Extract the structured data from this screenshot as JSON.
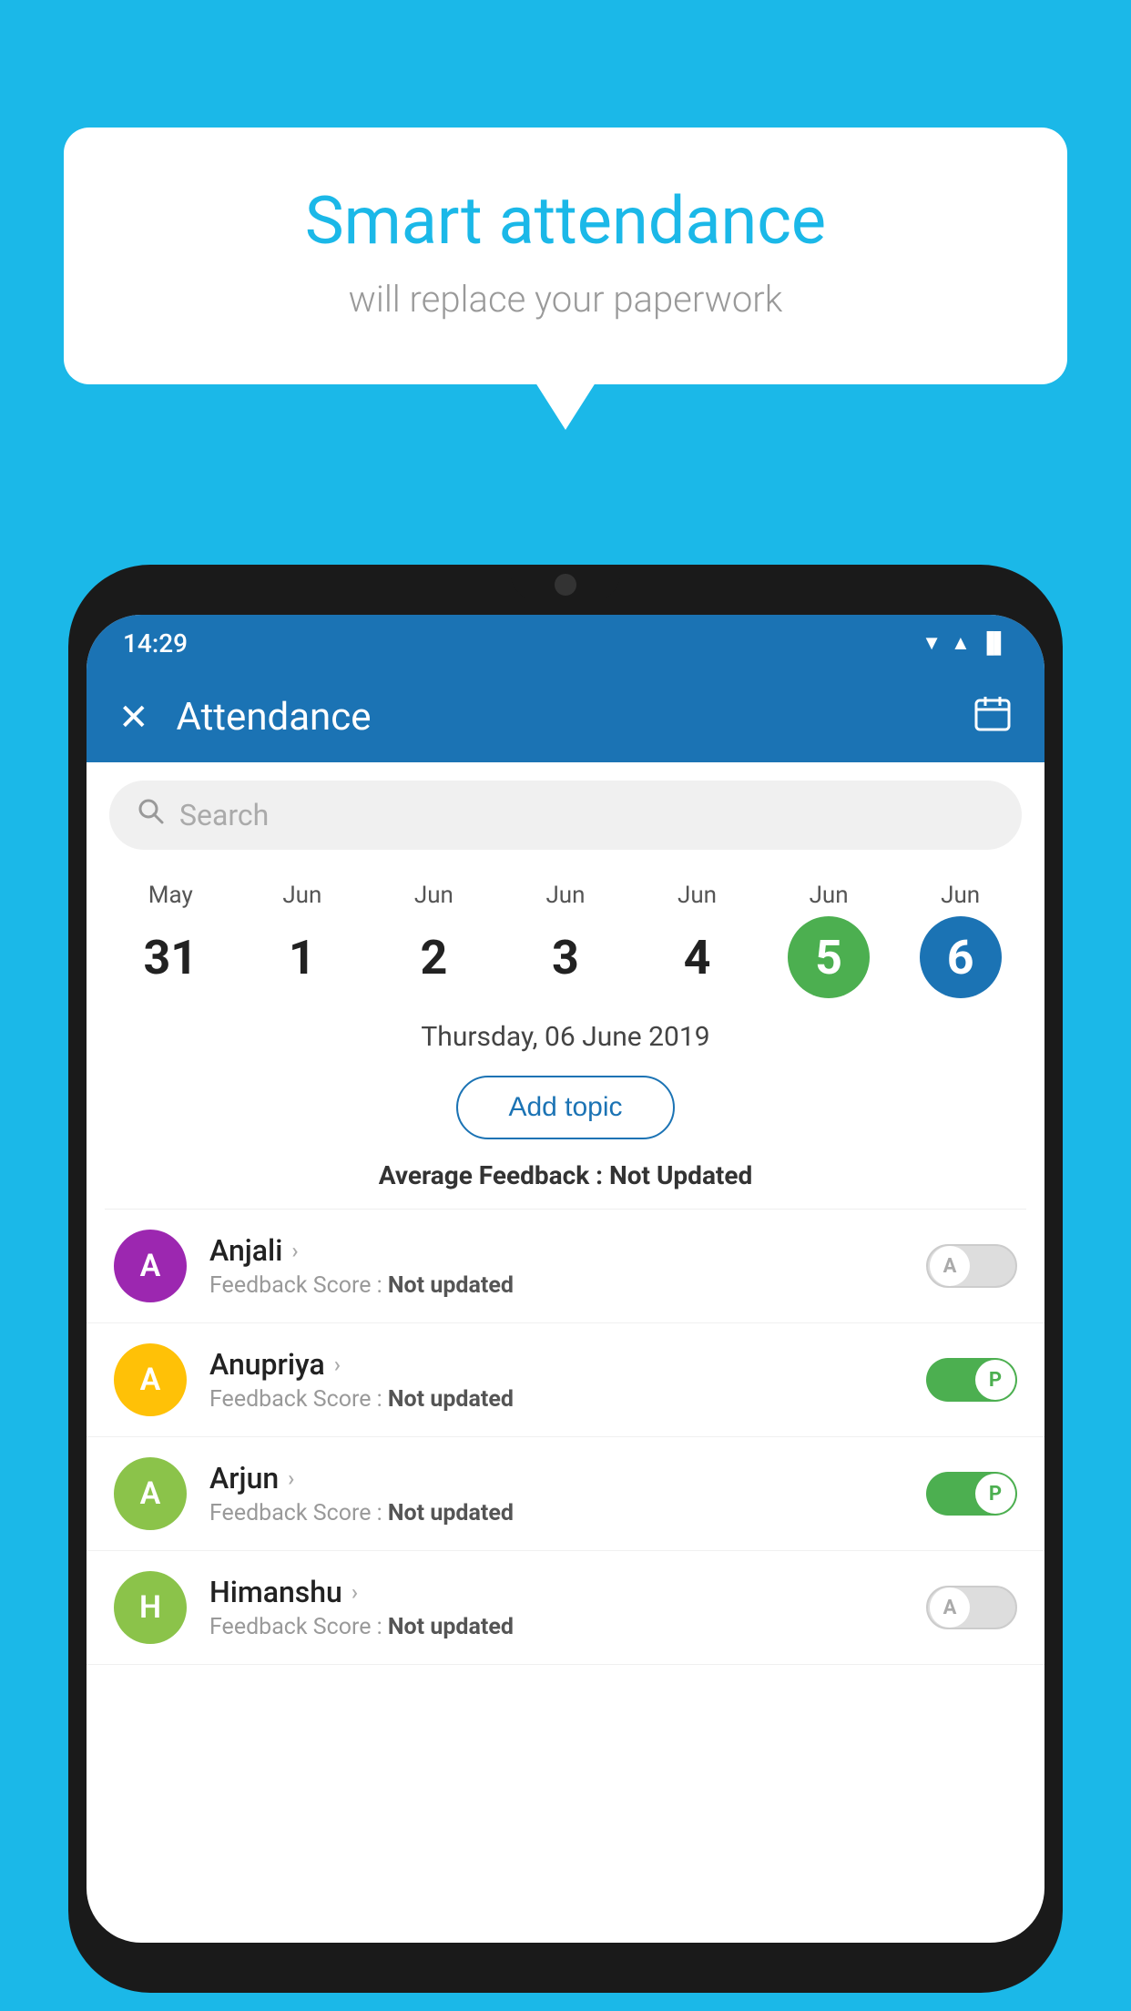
{
  "background_color": "#1BB8E8",
  "bubble": {
    "title": "Smart attendance",
    "subtitle": "will replace your paperwork"
  },
  "status_bar": {
    "time": "14:29",
    "wifi_icon": "▲",
    "signal_icon": "▲",
    "battery_icon": "▐"
  },
  "app_bar": {
    "title": "Attendance",
    "close_icon": "✕",
    "calendar_icon": "📅"
  },
  "search": {
    "placeholder": "Search"
  },
  "calendar": {
    "days": [
      {
        "month": "May",
        "date": "31",
        "style": "normal"
      },
      {
        "month": "Jun",
        "date": "1",
        "style": "normal"
      },
      {
        "month": "Jun",
        "date": "2",
        "style": "normal"
      },
      {
        "month": "Jun",
        "date": "3",
        "style": "normal"
      },
      {
        "month": "Jun",
        "date": "4",
        "style": "normal"
      },
      {
        "month": "Jun",
        "date": "5",
        "style": "today"
      },
      {
        "month": "Jun",
        "date": "6",
        "style": "selected"
      }
    ],
    "selected_date_text": "Thursday, 06 June 2019"
  },
  "add_topic_label": "Add topic",
  "avg_feedback_label": "Average Feedback : ",
  "avg_feedback_value": "Not Updated",
  "students": [
    {
      "name": "Anjali",
      "avatar_letter": "A",
      "avatar_color": "#9C27B0",
      "feedback": "Not updated",
      "present": false
    },
    {
      "name": "Anupriya",
      "avatar_letter": "A",
      "avatar_color": "#FFC107",
      "feedback": "Not updated",
      "present": true
    },
    {
      "name": "Arjun",
      "avatar_letter": "A",
      "avatar_color": "#8BC34A",
      "feedback": "Not updated",
      "present": true
    },
    {
      "name": "Himanshu",
      "avatar_letter": "H",
      "avatar_color": "#8BC34A",
      "feedback": "Not updated",
      "present": false
    }
  ],
  "feedback_score_label": "Feedback Score : "
}
